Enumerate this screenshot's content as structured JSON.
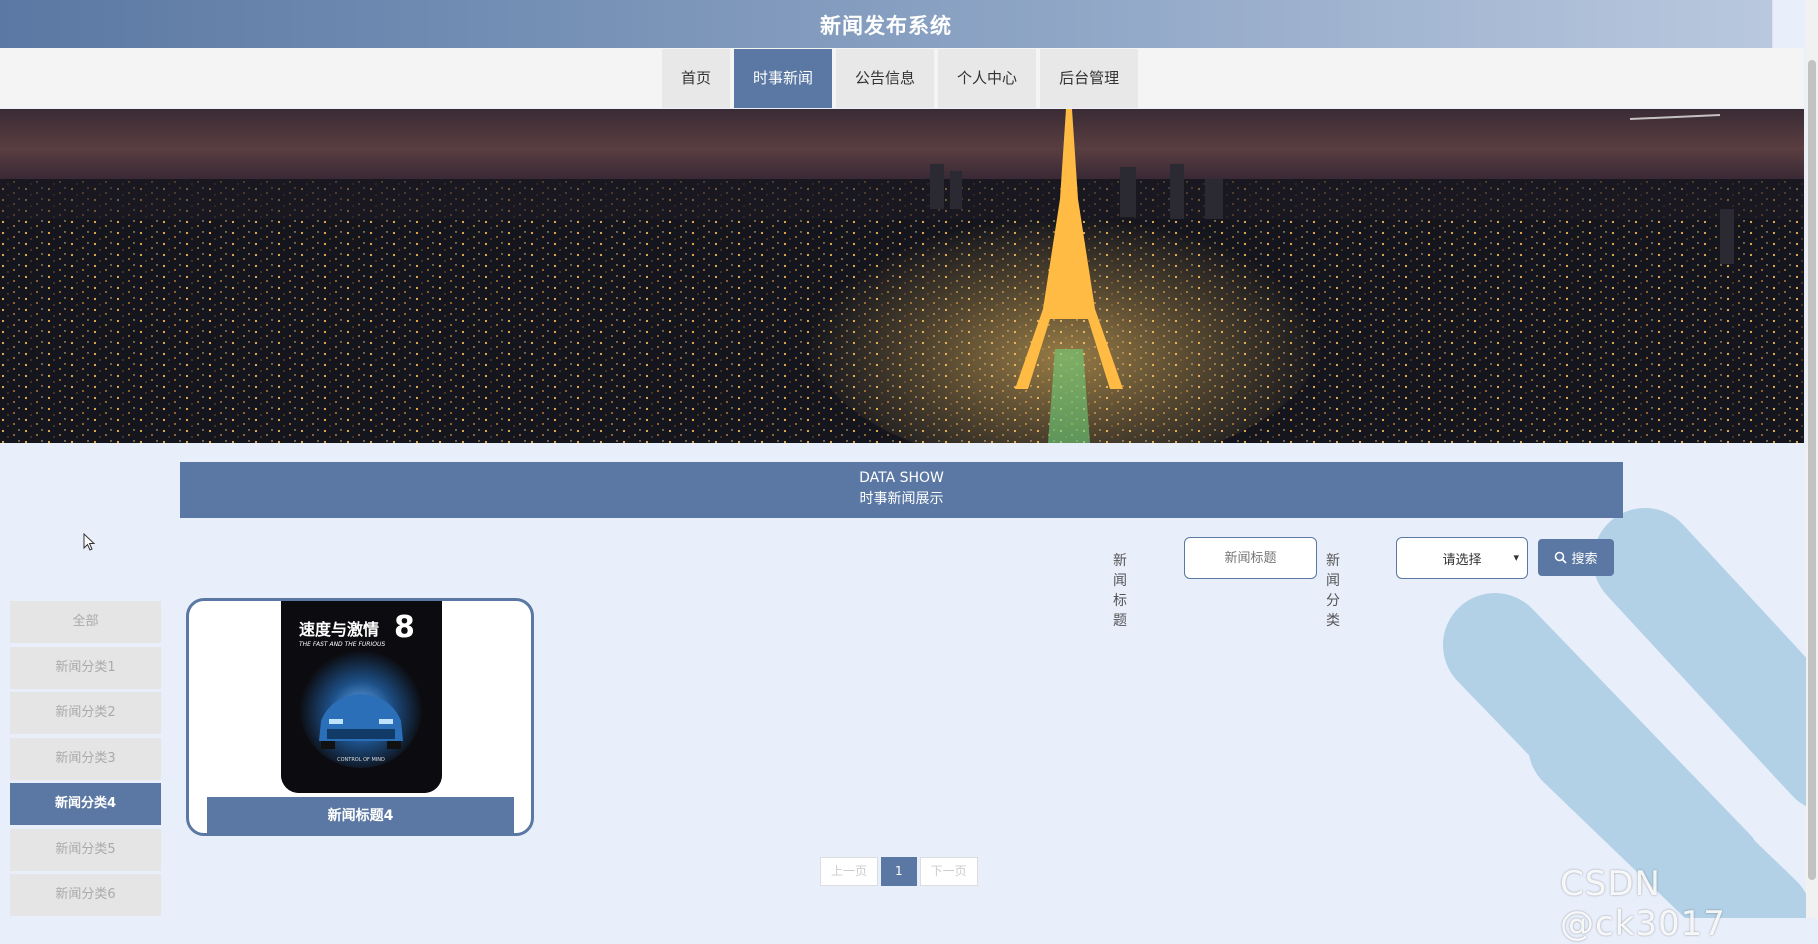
{
  "site": {
    "title": "新闻发布系统"
  },
  "nav": {
    "items": [
      {
        "label": "首页"
      },
      {
        "label": "时事新闻",
        "active": true
      },
      {
        "label": "公告信息"
      },
      {
        "label": "个人中心"
      },
      {
        "label": "后台管理"
      }
    ]
  },
  "section": {
    "title_en": "DATA SHOW",
    "title_cn": "时事新闻展示"
  },
  "search": {
    "title_label": "新闻标题",
    "title_placeholder": "新闻标题",
    "category_label": "新闻分类",
    "category_selected": "请选择",
    "button_label": "搜索"
  },
  "sidebar": {
    "items": [
      {
        "label": "全部"
      },
      {
        "label": "新闻分类1"
      },
      {
        "label": "新闻分类2"
      },
      {
        "label": "新闻分类3"
      },
      {
        "label": "新闻分类4",
        "active": true
      },
      {
        "label": "新闻分类5"
      },
      {
        "label": "新闻分类6"
      }
    ]
  },
  "cards": [
    {
      "title": "新闻标题4",
      "poster": {
        "headline": "速度与激情",
        "number": "8",
        "subtitle": "THE FAST AND THE FURIOUS",
        "tagline": "CONTROL OF MIND"
      }
    }
  ],
  "pagination": {
    "prev": "上一页",
    "current": "1",
    "next": "下一页"
  },
  "watermark": "CSDN @ck3017",
  "colors": {
    "primary": "#5a78a3",
    "background": "#e8eefa",
    "deco": "#b3d1e6"
  }
}
